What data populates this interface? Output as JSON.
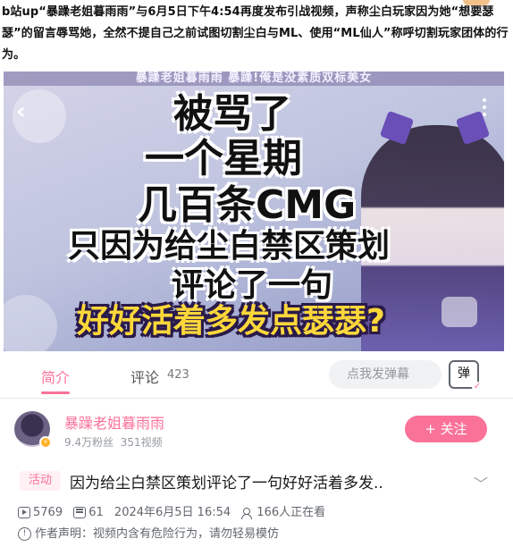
{
  "caption": "b站up“暴躁老姐暮雨雨”与6月5日下午4:54再度发布引战视频，声称尘白玩家因为她“想要瑟瑟”的留言辱骂她，全然不提自己之前试图切割尘白与ML、使用“ML仙人”称呼切割玩家团体的行为。",
  "video": {
    "banner": "暴躁老姐暮雨雨 暴躁!俺是没素质双标美女",
    "lines": [
      "被骂了",
      "一个星期",
      "几百条CMG",
      "只因为给尘白禁区策划",
      "评论了一句",
      "好好活着多发点瑟瑟?"
    ]
  },
  "tabs": {
    "intro": "简介",
    "comment": "评论",
    "comment_count": "423"
  },
  "danmaku": {
    "placeholder": "点我发弹幕",
    "button": "弹"
  },
  "uploader": {
    "name": "暴躁老姐暮雨雨",
    "fans": "9.4万粉丝",
    "videos": "351视频",
    "follow": "+ 关注"
  },
  "video_info": {
    "tag": "活动",
    "title": "因为给尘白禁区策划评论了一句好好活着多发..",
    "views": "5769",
    "danmaku_count": "61",
    "date": "2024年6月5日 16:54",
    "watching": "166人正在看",
    "notice": "作者声明：视频内含有危险行为，请勿轻易模仿"
  },
  "colors": {
    "accent": "#fb7299",
    "text": "#18191c",
    "muted": "#9499a0"
  }
}
